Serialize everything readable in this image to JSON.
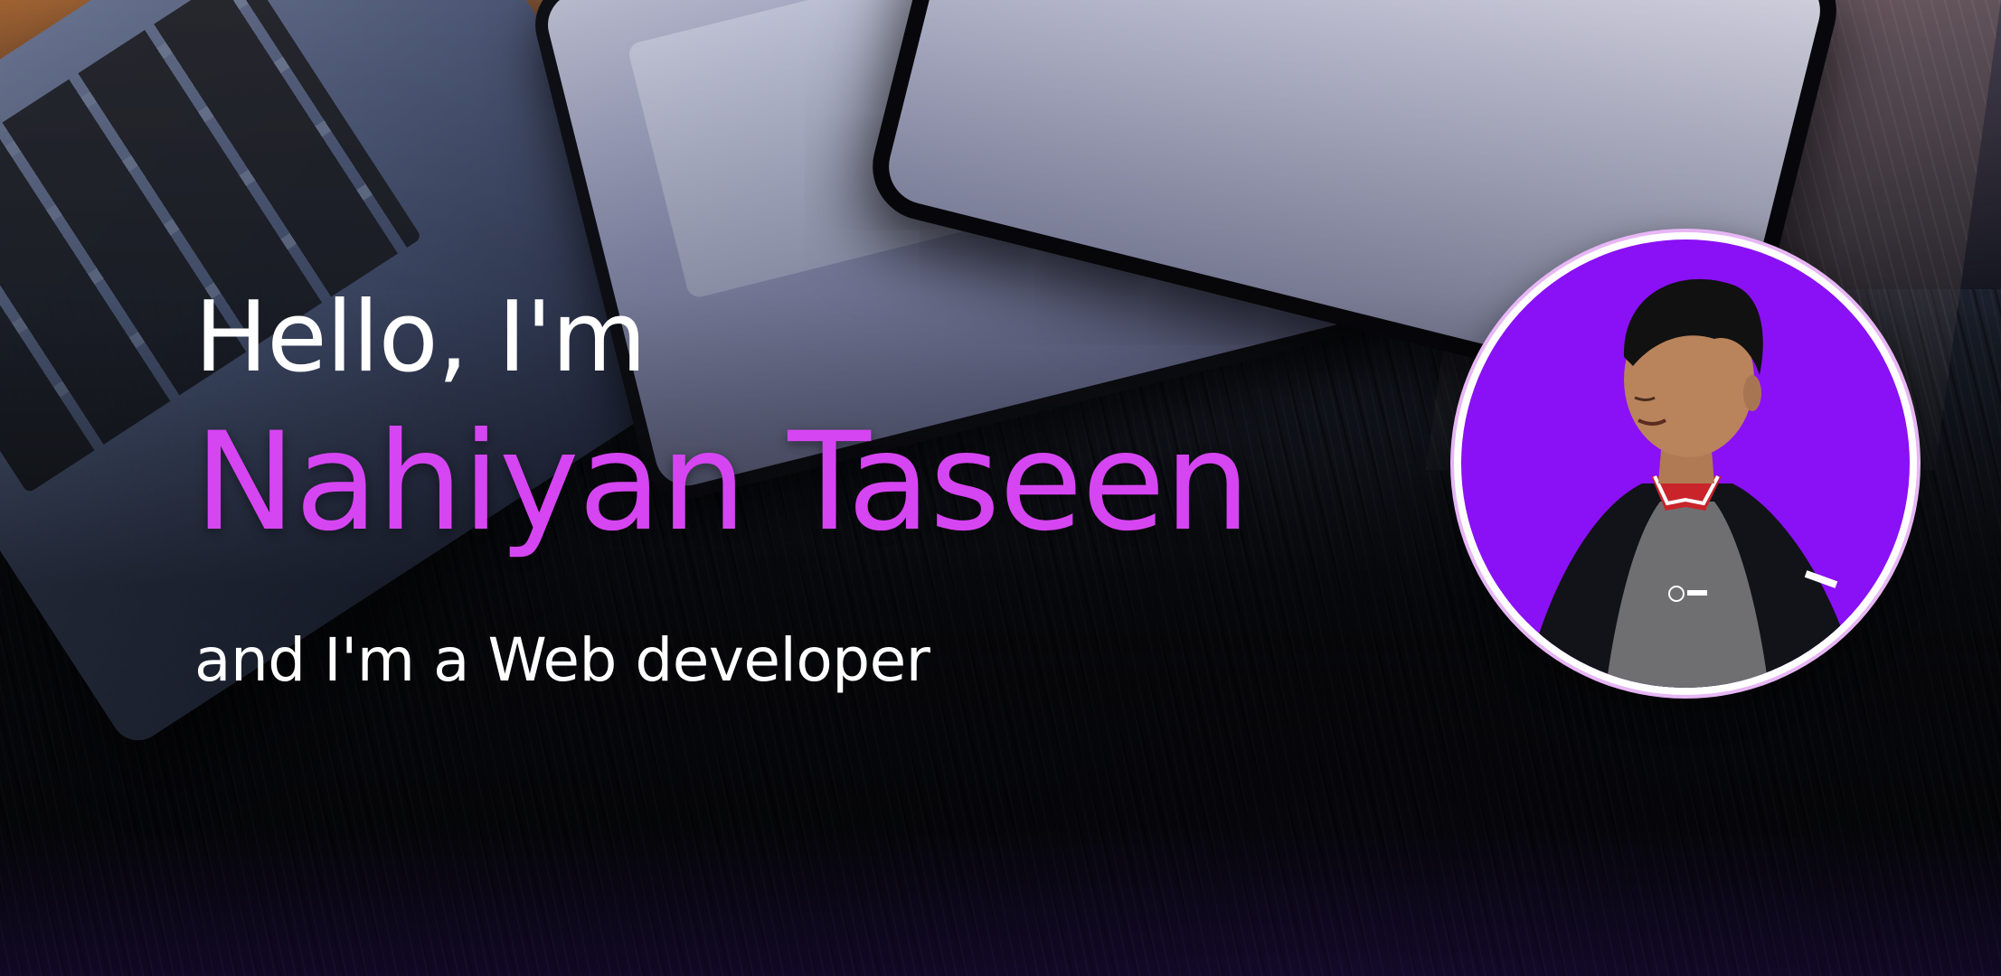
{
  "hero": {
    "greeting": "Hello, I'm",
    "name": "Nahiyan Taseen",
    "role": "and I'm a Web developer"
  },
  "avatar": {
    "icon": "profile-photo",
    "background_color": "#8a10f5",
    "ring_color": "#e7b6f5"
  },
  "colors": {
    "accent": "#d645f2",
    "text": "#ffffff"
  }
}
